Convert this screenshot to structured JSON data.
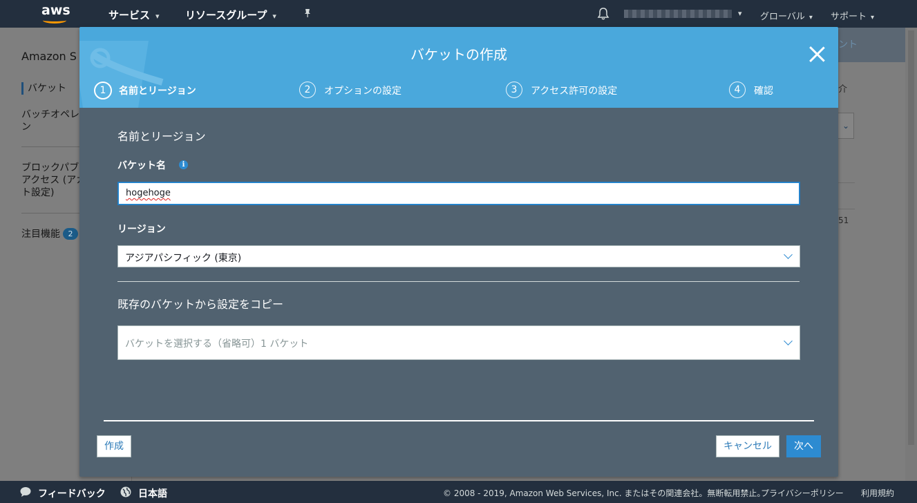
{
  "topnav": {
    "logo": "aws",
    "services": "サービス",
    "resource_groups": "リソースグループ",
    "pin_icon": "pin-icon",
    "bell_icon": "bell-icon",
    "global": "グローバル",
    "support": "サポート"
  },
  "background": {
    "title": "Amazon S",
    "nav": {
      "buckets": "バケット",
      "batch1": "バッチオペレ",
      "batch2": "ン",
      "block1": "ブロックパブ",
      "block2": "アクセス (アカ",
      "block3": "ト設定)",
      "featured": "注目機能",
      "featured_count": "2"
    },
    "right_header": "ント",
    "right_text": "介",
    "right_number": "51"
  },
  "modal": {
    "title": "バケットの作成",
    "steps": [
      {
        "num": "1",
        "label": "名前とリージョン"
      },
      {
        "num": "2",
        "label": "オプションの設定"
      },
      {
        "num": "3",
        "label": "アクセス許可の設定"
      },
      {
        "num": "4",
        "label": "確認"
      }
    ],
    "section_title": "名前とリージョン",
    "bucket_name_label": "バケット名",
    "bucket_name_value": "hogehoge",
    "region_label": "リージョン",
    "region_value": "アジアパシフィック (東京)",
    "copy_title": "既存のバケットから設定をコピー",
    "copy_placeholder": "バケットを選択する（省略可）1 バケット",
    "create_button": "作成",
    "cancel_button": "キャンセル",
    "next_button": "次へ"
  },
  "footer": {
    "feedback": "フィードバック",
    "language": "日本語",
    "copyright": "© 2008 - 2019, Amazon Web Services, Inc. またはその関連会社。無断転用禁止。",
    "privacy": "プライバシーポリシー",
    "terms": "利用規約"
  },
  "colors": {
    "nav_bg": "#232f3e",
    "modal_header": "#4aa8dc",
    "modal_body": "#516270",
    "primary": "#2d8bd1",
    "aws_orange": "#ff9900"
  }
}
